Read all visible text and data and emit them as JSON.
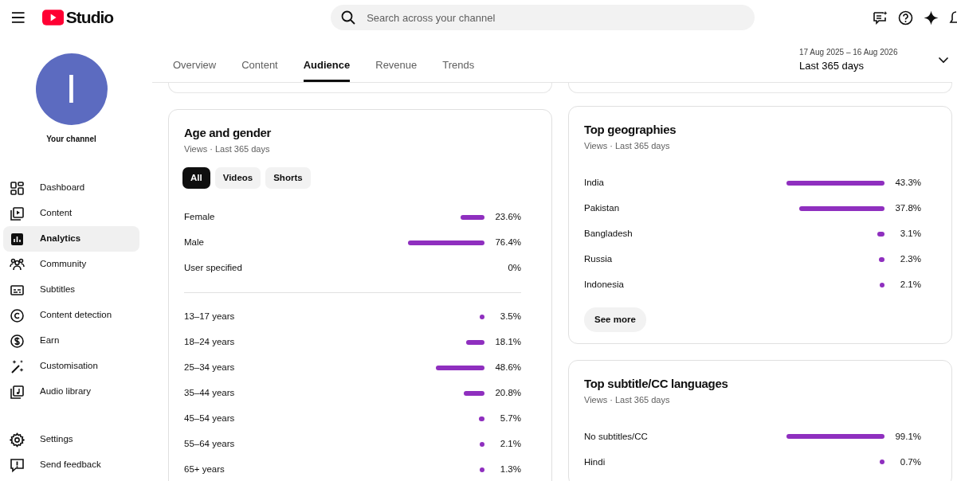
{
  "header": {
    "logo_text": "Studio",
    "search_placeholder": "Search across your channel"
  },
  "channel": {
    "avatar_letter": "I",
    "label": "Your channel"
  },
  "nav": [
    {
      "label": "Dashboard",
      "selected": false
    },
    {
      "label": "Content",
      "selected": false
    },
    {
      "label": "Analytics",
      "selected": true
    },
    {
      "label": "Community",
      "selected": false
    },
    {
      "label": "Subtitles",
      "selected": false
    },
    {
      "label": "Content detection",
      "selected": false
    },
    {
      "label": "Earn",
      "selected": false
    },
    {
      "label": "Customisation",
      "selected": false
    },
    {
      "label": "Audio library",
      "selected": false
    }
  ],
  "nav_bottom": [
    {
      "label": "Settings",
      "selected": false
    },
    {
      "label": "Send feedback",
      "selected": false
    }
  ],
  "tabs": [
    {
      "label": "Overview",
      "selected": false
    },
    {
      "label": "Content",
      "selected": false
    },
    {
      "label": "Audience",
      "selected": true
    },
    {
      "label": "Revenue",
      "selected": false
    },
    {
      "label": "Trends",
      "selected": false
    }
  ],
  "date_range": {
    "dates": "17 Aug 2025 – 16 Aug 2026",
    "label": "Last 365 days"
  },
  "age_gender": {
    "title": "Age and gender",
    "subtitle": "Views · Last 365 days",
    "filters": [
      {
        "label": "All",
        "selected": true
      },
      {
        "label": "Videos",
        "selected": false
      },
      {
        "label": "Shorts",
        "selected": false
      }
    ],
    "gender": [
      {
        "label": "Female",
        "value": "23.6%"
      },
      {
        "label": "Male",
        "value": "76.4%"
      },
      {
        "label": "User specified",
        "value": "0%"
      }
    ],
    "ages": [
      {
        "label": "13–17 years",
        "value": "3.5%"
      },
      {
        "label": "18–24 years",
        "value": "18.1%"
      },
      {
        "label": "25–34 years",
        "value": "48.6%"
      },
      {
        "label": "35–44 years",
        "value": "20.8%"
      },
      {
        "label": "45–54 years",
        "value": "5.7%"
      },
      {
        "label": "55–64 years",
        "value": "2.1%"
      },
      {
        "label": "65+ years",
        "value": "1.3%"
      }
    ]
  },
  "geographies": {
    "title": "Top geographies",
    "subtitle": "Views · Last 365 days",
    "rows": [
      {
        "label": "India",
        "value": "43.3%"
      },
      {
        "label": "Pakistan",
        "value": "37.8%"
      },
      {
        "label": "Bangladesh",
        "value": "3.1%"
      },
      {
        "label": "Russia",
        "value": "2.3%"
      },
      {
        "label": "Indonesia",
        "value": "2.1%"
      }
    ],
    "button": "See more"
  },
  "subtitle_languages": {
    "title": "Top subtitle/CC languages",
    "subtitle": "Views · Last 365 days",
    "rows": [
      {
        "label": "No subtitles/CC",
        "value": "99.1%"
      },
      {
        "label": "Hindi",
        "value": "0.7%"
      }
    ]
  }
}
